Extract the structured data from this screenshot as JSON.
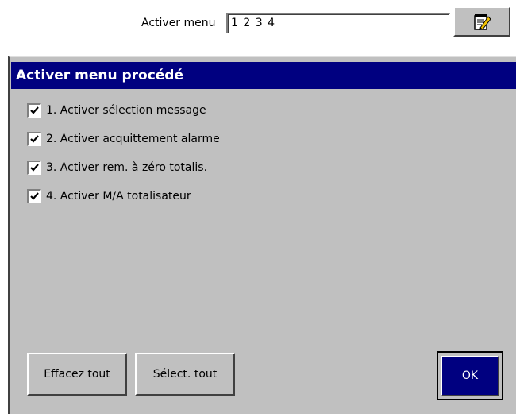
{
  "topbar": {
    "label": "Activer menu",
    "field_value": "1 2 3 4",
    "edit_button_icon": "edit-notepad-icon"
  },
  "dialog": {
    "title": "Activer menu procédé",
    "items": [
      {
        "label": "1. Activer sélection message",
        "checked": true
      },
      {
        "label": "2. Activer acquittement alarme",
        "checked": true
      },
      {
        "label": "3. Activer rem. à zéro totalis.",
        "checked": true
      },
      {
        "label": "4. Activer M/A totalisateur",
        "checked": true
      }
    ],
    "buttons": {
      "clear_all": "Effacez tout",
      "select_all": "Sélect. tout",
      "ok": "OK"
    }
  },
  "colors": {
    "title_bar": "#000080",
    "panel": "#c0c0c0"
  }
}
